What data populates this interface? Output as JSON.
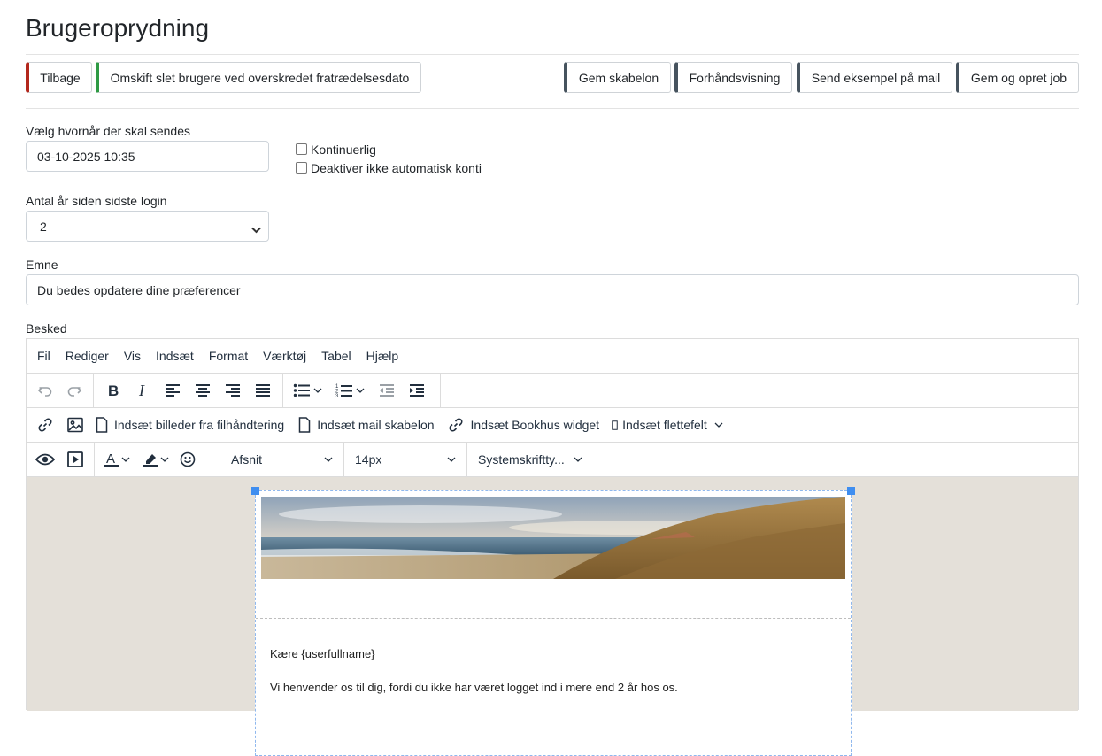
{
  "page": {
    "title": "Brugeroprydning"
  },
  "toolbar": {
    "back_label": "Tilbage",
    "toggle_label": "Omskift slet brugere ved overskredet fratrædelsesdato",
    "save_template_label": "Gem skabelon",
    "preview_label": "Forhåndsvisning",
    "send_example_label": "Send eksempel på mail",
    "save_create_job_label": "Gem og opret job"
  },
  "form": {
    "send_when_label": "Vælg hvornår der skal sendes",
    "send_when_value": "03-10-2025 10:35",
    "continuous_label": "Kontinuerlig",
    "continuous_checked": false,
    "no_auto_deactivate_label": "Deaktiver ikke automatisk konti",
    "no_auto_deactivate_checked": false,
    "years_label": "Antal år siden sidste login",
    "years_value": "2",
    "subject_label": "Emne",
    "subject_value": "Du bedes opdatere dine præferencer",
    "message_label": "Besked"
  },
  "editor": {
    "menu": [
      "Fil",
      "Rediger",
      "Vis",
      "Indsæt",
      "Format",
      "Værktøj",
      "Tabel",
      "Hjælp"
    ],
    "insert_images_label": "Indsæt billeder fra filhåndtering",
    "insert_mail_template_label": "Indsæt mail skabelon",
    "insert_widget_label": "Indsæt Bookhus widget",
    "insert_mergefield_label": "Indsæt flettefelt",
    "block_format": "Afsnit",
    "font_size": "14px",
    "font_family": "Systemskriftty...",
    "content": {
      "greeting": "Kære {userfullname}",
      "paragraph1": "Vi henvender os til dig, fordi du ikke har været logget ind i mere end 2 år hos os."
    }
  },
  "colors": {
    "back_accent": "#b3281d",
    "toggle_accent": "#2e9a44",
    "action_accent": "#46535e",
    "editor_canvas": "#e4e0d9",
    "selection": "#3f8ef0"
  }
}
